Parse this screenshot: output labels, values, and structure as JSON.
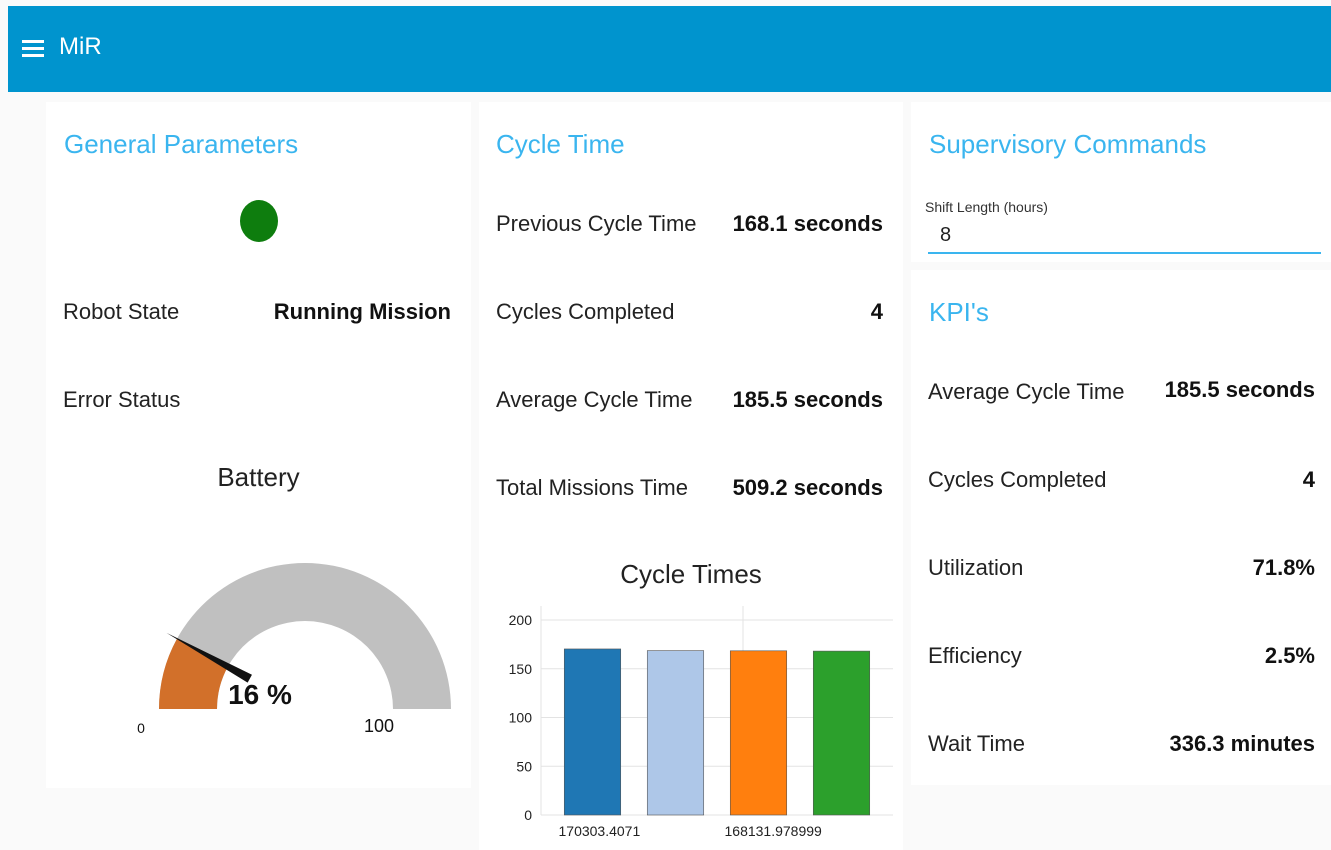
{
  "header": {
    "title": "MiR",
    "menu_icon": "hamburger-menu-icon"
  },
  "general": {
    "title": "General Parameters",
    "status_color": "#0e7d0e",
    "robot_state_label": "Robot State",
    "robot_state_value": "Running Mission",
    "error_status_label": "Error Status",
    "error_status_value": "",
    "battery": {
      "title": "Battery",
      "value": 16,
      "value_text": "16 %",
      "min_label": "0",
      "max_label": "100",
      "fill_color": "#d2702a",
      "track_color": "#c0c0c0"
    }
  },
  "cycle": {
    "title": "Cycle Time",
    "rows": [
      {
        "label": "Previous Cycle Time",
        "value": "168.1 seconds"
      },
      {
        "label": "Cycles Completed",
        "value": "4"
      },
      {
        "label": "Average Cycle Time",
        "value": "185.5 seconds"
      },
      {
        "label": "Total Missions Time",
        "value": "509.2 seconds"
      }
    ]
  },
  "supervisory": {
    "title": "Supervisory Commands",
    "shift_label": "Shift Length (hours)",
    "shift_value": "8"
  },
  "kpis": {
    "title": "KPI's",
    "rows": [
      {
        "label": "Average Cycle Time",
        "value": "185.5 seconds"
      },
      {
        "label": "Cycles Completed",
        "value": "4"
      },
      {
        "label": "Utilization",
        "value": "71.8%"
      },
      {
        "label": "Efficiency",
        "value": "2.5%"
      },
      {
        "label": "Wait Time",
        "value": "336.3 minutes"
      }
    ]
  },
  "chart_data": {
    "type": "bar",
    "title": "Cycle Times",
    "xlabel": "",
    "ylabel": "",
    "ylim": [
      0,
      200
    ],
    "yticks": [
      0,
      50,
      100,
      150,
      200
    ],
    "categories": [
      "170303.4071",
      "",
      "168131.978999",
      ""
    ],
    "x_tick_labels": [
      "170303.4071",
      "168131.978999"
    ],
    "values": [
      170.3,
      168.6,
      168.4,
      168.1
    ],
    "colors": [
      "#1f77b4",
      "#aec7e8",
      "#ff7f0e",
      "#2ca02c"
    ],
    "grid": true,
    "legend": "none"
  }
}
